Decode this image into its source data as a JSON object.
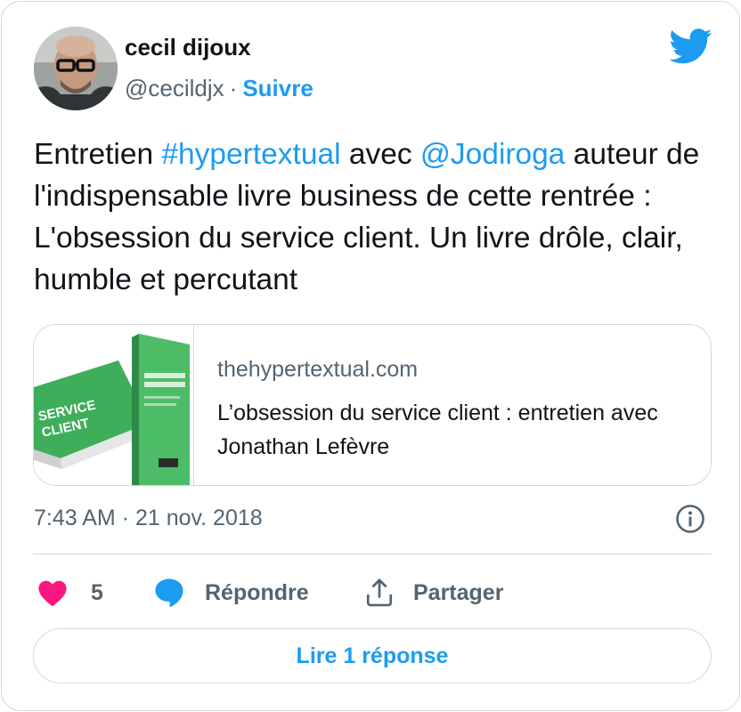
{
  "author": {
    "name": "cecil dijoux",
    "handle": "@cecildjx",
    "separator": "·",
    "follow_label": "Suivre"
  },
  "tweet": {
    "segments": [
      {
        "text": "Entretien ",
        "type": "text"
      },
      {
        "text": "#hypertextual",
        "type": "hashtag"
      },
      {
        "text": " avec ",
        "type": "text"
      },
      {
        "text": "@Jodiroga",
        "type": "mention"
      },
      {
        "text": " auteur de l'indispensable livre business de cette rentrée : L'obsession du service client. Un livre drôle, clair, humble et percutant",
        "type": "text"
      }
    ]
  },
  "link_card": {
    "domain": "thehypertextual.com",
    "title": "L’obsession du service client : entretien avec Jonathan Lefèvre",
    "thumbnail": {
      "book_title_line1": "SERVICE",
      "book_title_line2": "CLIENT"
    }
  },
  "meta": {
    "timestamp": "7:43 AM · 21 nov. 2018"
  },
  "actions": {
    "like_count": "5",
    "reply_label": "Répondre",
    "share_label": "Partager"
  },
  "read_replies_label": "Lire 1 réponse",
  "colors": {
    "accent": "#1d9bf0",
    "like": "#f91880",
    "text": "#0f1419",
    "secondary": "#536471",
    "border": "#cfd9de"
  }
}
